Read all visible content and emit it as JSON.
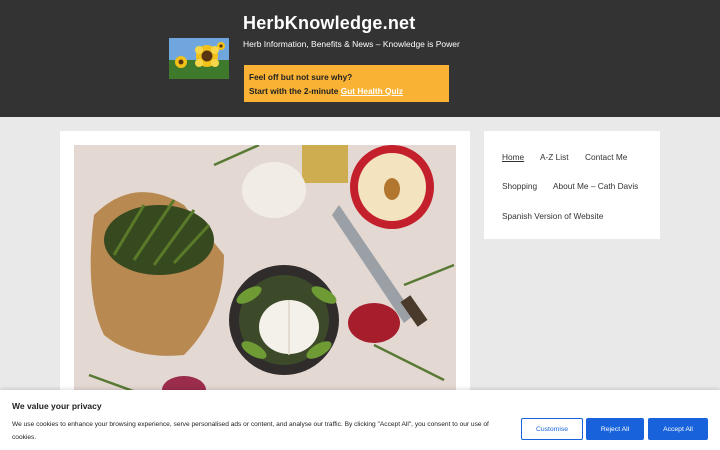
{
  "header": {
    "site_title": "HerbKnowledge.net",
    "tagline": "Herb Information, Benefits & News – Knowledge is Power",
    "promo_line1": "Feel off but not sure why?",
    "promo_line2": "Start with the 2-minute",
    "promo_link": "Gut Health Quiz",
    "logo_icon": "sunflower-logo"
  },
  "nav": {
    "items": [
      {
        "label": "Home",
        "active": true
      },
      {
        "label": "A-Z List"
      },
      {
        "label": "Contact Me"
      },
      {
        "label": "Shopping"
      },
      {
        "label": "About Me – Cath Davis"
      },
      {
        "label": "Spanish Version of Website"
      }
    ]
  },
  "hero_image": "herbs-garlic-apple-photo",
  "cookie": {
    "title": "We value your privacy",
    "text": "We use cookies to enhance your browsing experience, serve personalised ads or content, and analyse our traffic. By clicking \"Accept All\", you consent to our use of cookies.",
    "customise_label": "Customise",
    "reject_label": "Reject All",
    "accept_label": "Accept All"
  },
  "colors": {
    "header_bg": "#333333",
    "promo_bg": "#f9b233",
    "page_bg": "#e9e9e9",
    "button_blue": "#1863dc"
  }
}
